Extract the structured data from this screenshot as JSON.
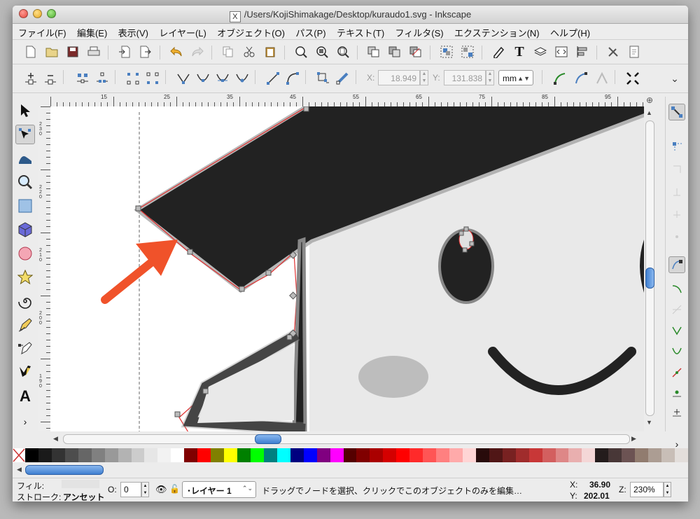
{
  "window": {
    "title": "/Users/KojiShimakage/Desktop/kuraudo1.svg - Inkscape",
    "app_icon_glyph": "X"
  },
  "menu": [
    "ファイル(F)",
    "編集(E)",
    "表示(V)",
    "レイヤー(L)",
    "オブジェクト(O)",
    "パス(P)",
    "テキスト(T)",
    "フィルタ(S)",
    "エクステンション(N)",
    "ヘルプ(H)"
  ],
  "toolbar_commands": [
    "new-icon",
    "open-icon",
    "save-icon",
    "print-icon",
    "import-icon",
    "export-icon",
    "undo-icon",
    "redo-icon",
    "copy-icon",
    "cut-icon",
    "paste-icon",
    "zoom-selection-icon",
    "zoom-drawing-icon",
    "zoom-page-icon",
    "duplicate-icon",
    "clone-icon",
    "unlink-clone-icon",
    "group-icon",
    "ungroup-icon",
    "fill-stroke-icon",
    "text-font-icon",
    "layers-icon",
    "xml-editor-icon",
    "align-icon",
    "preferences-icon",
    "document-properties-icon"
  ],
  "node_toolbar": {
    "x_label": "X:",
    "x_value": "18.949",
    "y_label": "Y:",
    "y_value": "131.838",
    "unit": "mm"
  },
  "hruler_labels": [
    "15",
    "25",
    "35",
    "45",
    "55",
    "65",
    "75",
    "85",
    "95"
  ],
  "vruler_labels": [
    "2 3 0",
    "2 2 0",
    "2 1 0",
    "2 0 0",
    "1 9 0"
  ],
  "palette": [
    "#000000",
    "#1a1a1a",
    "#333333",
    "#4d4d4d",
    "#666666",
    "#808080",
    "#999999",
    "#b3b3b3",
    "#cccccc",
    "#e6e6e6",
    "#f2f2f2",
    "#ffffff",
    "#800000",
    "#ff0000",
    "#808000",
    "#ffff00",
    "#008000",
    "#00ff00",
    "#008080",
    "#00ffff",
    "#000080",
    "#0000ff",
    "#800080",
    "#ff00ff",
    "#550000",
    "#800000",
    "#aa0000",
    "#d40000",
    "#ff0000",
    "#ff2a2a",
    "#ff5555",
    "#ff8080",
    "#ffaaaa",
    "#ffd5d5",
    "#280b0b",
    "#501616",
    "#782121",
    "#a02c2c",
    "#c83737",
    "#d35f5f",
    "#de8787",
    "#e9afaf",
    "#f4d7d7",
    "#241c1c",
    "#483737",
    "#6c5353",
    "#917c6f",
    "#ac9d93",
    "#c8beb7",
    "#e3dedb"
  ],
  "status": {
    "fill_label": "フィル:",
    "stroke_label": "ストローク:",
    "stroke_value": "アンセット",
    "opacity_label": "O:",
    "opacity_value": "0",
    "layer": "･レイヤー 1",
    "message": "ドラッグでノードを選択、クリックでこのオブジェクトのみを編集…",
    "coord_x_label": "X:",
    "coord_x": "36.90",
    "coord_y_label": "Y:",
    "coord_y": "202.01",
    "zoom_label": "Z:",
    "zoom": "230%"
  },
  "colors": {
    "accent_arrow": "#f0522a",
    "path_outline": "#e03030",
    "node_gray": "#888888",
    "shape_fill": "#222222"
  }
}
